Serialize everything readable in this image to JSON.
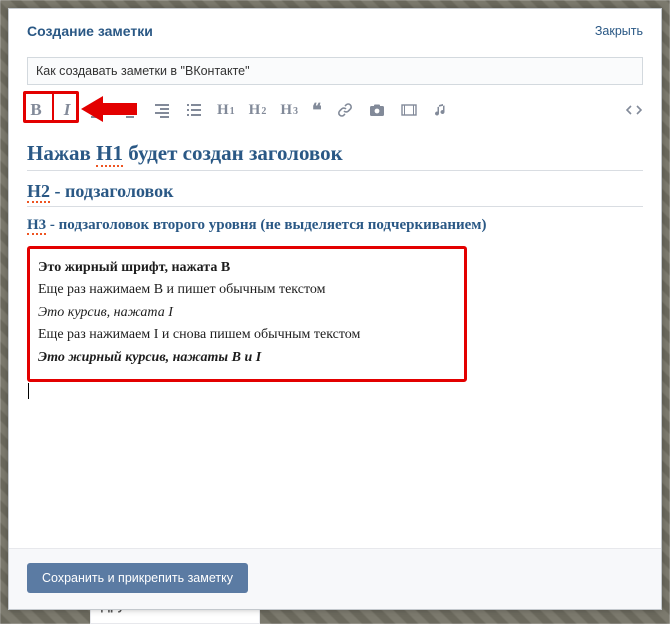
{
  "behind": {
    "sidebar_label": "Друзья онлайн"
  },
  "modal": {
    "title": "Создание заметки",
    "close_label": "Закрыть",
    "title_input_value": "Как создавать заметки в \"ВКонтакте\"",
    "save_label": "Сохранить и прикрепить заметку"
  },
  "toolbar": {
    "bold": "B",
    "italic": "I",
    "h1": "H",
    "h1_sub": "1",
    "h2": "H",
    "h2_sub": "2",
    "h3": "H",
    "h3_sub": "3",
    "quote": "❝"
  },
  "content": {
    "h1_pre": "Нажав ",
    "h1_hl": "H1",
    "h1_post": " будет создан заголовок",
    "h2_pre": "H2",
    "h2_post": " - подзаголовок",
    "h3_pre": "H3",
    "h3_post": " - подзаголовок второго уровня (не выделяется подчеркиванием)",
    "p_bold": "Это жирный шрифт, нажата B",
    "p_after_bold": "Еще раз нажимаем В и пишет обычным текстом",
    "p_italic": "Это курсив, нажата I",
    "p_after_italic": "Еще раз нажимаем I и снова пишем обычным текстом",
    "p_bolditalic": "Это жирный курсив, нажаты B и I"
  }
}
